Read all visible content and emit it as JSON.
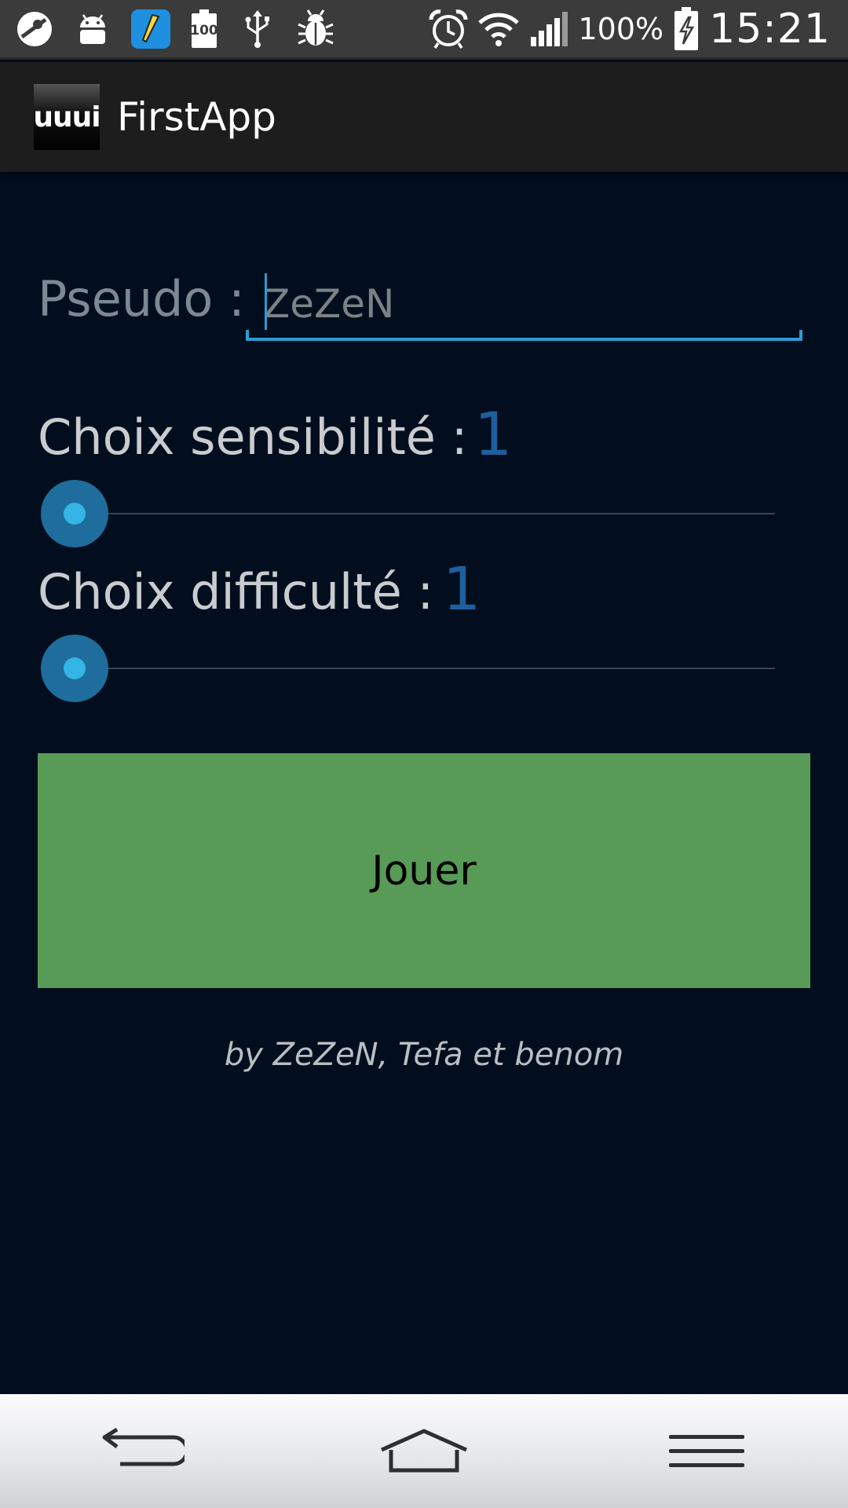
{
  "status_bar": {
    "left_icons": [
      "web-browser-icon",
      "android-icon",
      "sketch-app-icon",
      "battery-100-icon",
      "usb-icon",
      "debug-bug-icon"
    ],
    "battery_widget_text": "100",
    "right_icons": [
      "alarm-clock-icon",
      "wifi-icon",
      "cell-signal-icon",
      "battery-charging-icon"
    ],
    "battery_percent": "100%",
    "time": "15:21"
  },
  "action_bar": {
    "app_icon_text": "uuui",
    "title": "FirstApp"
  },
  "form": {
    "pseudo_label": "Pseudo :",
    "pseudo_value": "ZeZeN",
    "sensitivity_label": "Choix sensibilité :",
    "sensitivity_value": "1",
    "sensitivity_level": 0,
    "difficulty_label": "Choix difficulté :",
    "difficulty_value": "1",
    "difficulty_level": 0,
    "play_label": "Jouer",
    "credits": "by ZeZeN, Tefa et benom"
  },
  "nav_bar": {
    "buttons": [
      "back-icon",
      "home-icon",
      "menu-icon"
    ]
  },
  "colors": {
    "background": "#020e1e",
    "accent": "#33b5e5",
    "value_blue": "#1d5f9f",
    "button_green": "#589b56"
  }
}
